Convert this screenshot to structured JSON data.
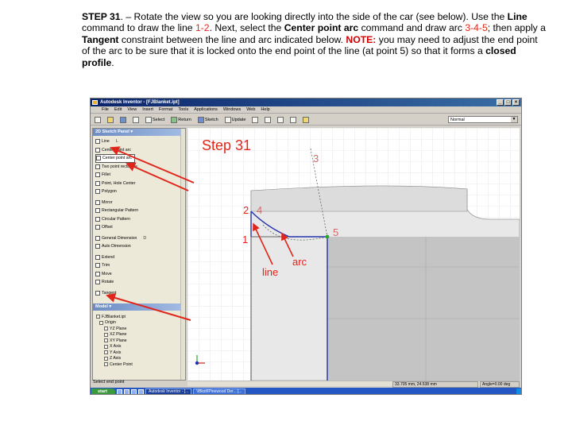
{
  "instructions": {
    "step": "STEP 31",
    "dash_sep": ". – Rotate the view so you are looking directly into the side of the car (see below). Use the ",
    "line_cmd": "Line",
    "l2_a": "command to draw the line ",
    "pts_12": "1-2",
    "l2_b": ". Next, select the ",
    "center_cmd": "Center point arc",
    "l2_c": " command and draw arc ",
    "pts_345": "3-4-5",
    "l2_d": "; then apply a",
    "tangent": "Tangent",
    "l3_a": " constraint between the line and arc indicated below. ",
    "note": "NOTE:",
    "l3_b": "  you may need to adjust the end point",
    "l4": "of the arc to be sure that it is locked onto the end point of the line (at point 5) so that it forms a ",
    "closed": "closed",
    "profile": "profile",
    "end": "."
  },
  "window": {
    "title": "Autodesk Inventor - [FJBlanket.ipt]",
    "menus": [
      "File",
      "Edit",
      "View",
      "Insert",
      "Format",
      "Tools",
      "Applications",
      "Windows",
      "Web",
      "Help"
    ],
    "toolbar": {
      "select": "Select",
      "return": "Return",
      "sketch": "Sketch",
      "update": "Update"
    },
    "combo_value": "Normal"
  },
  "panel": {
    "header": "2D Sketch Panel",
    "commands": [
      {
        "label": "Line",
        "shortcut": "L"
      },
      {
        "label": "Center point arc",
        "shortcut": ""
      },
      {
        "label": "Center point arc",
        "shortcut": ""
      },
      {
        "label": "Two point rectangle",
        "shortcut": ""
      },
      {
        "label": "Fillet",
        "shortcut": ""
      },
      {
        "label": "Point, Hole Center",
        "shortcut": ""
      },
      {
        "label": "Polygon",
        "shortcut": ""
      },
      {
        "label": "Mirror",
        "shortcut": ""
      },
      {
        "label": "Rectangular Pattern",
        "shortcut": ""
      },
      {
        "label": "Circular Pattern",
        "shortcut": ""
      },
      {
        "label": "Offset",
        "shortcut": ""
      },
      {
        "label": "General Dimension",
        "shortcut": "D"
      },
      {
        "label": "Auto Dimension",
        "shortcut": ""
      },
      {
        "label": "Extend",
        "shortcut": ""
      },
      {
        "label": "Trim",
        "shortcut": ""
      },
      {
        "label": "Move",
        "shortcut": ""
      },
      {
        "label": "Rotate",
        "shortcut": ""
      },
      {
        "label": "Tangent",
        "shortcut": ""
      }
    ],
    "model_header": "Model",
    "tree": [
      "FJBlanket.ipt",
      "Origin",
      "YZ Plane",
      "XZ Plane",
      "XY Plane",
      "X Axis",
      "Y Axis",
      "Z Axis",
      "Center Point"
    ]
  },
  "status": {
    "prompt": "Select end point",
    "coords": "33.705 mm, 24.538 mm",
    "angle": "Angle=0.00 deg"
  },
  "taskbar": {
    "start": "start",
    "items": [
      "Autodesk Inventor - [...",
      "\\\\Bkstl\\Pinewood Der... [..."
    ],
    "clock": ""
  },
  "overlay": {
    "step_label": "Step 31",
    "p1": "1",
    "p2": "2",
    "p3": "3",
    "p4": "4",
    "p5": "5",
    "line_label": "line",
    "arc_label": "arc"
  },
  "colors": {
    "highlight_red": "#e0261c",
    "point_pink": "#d46a6a",
    "arrow_red": "#e0261c",
    "sketch_blue": "#2233aa",
    "body_gray": "#c8c8c8"
  }
}
